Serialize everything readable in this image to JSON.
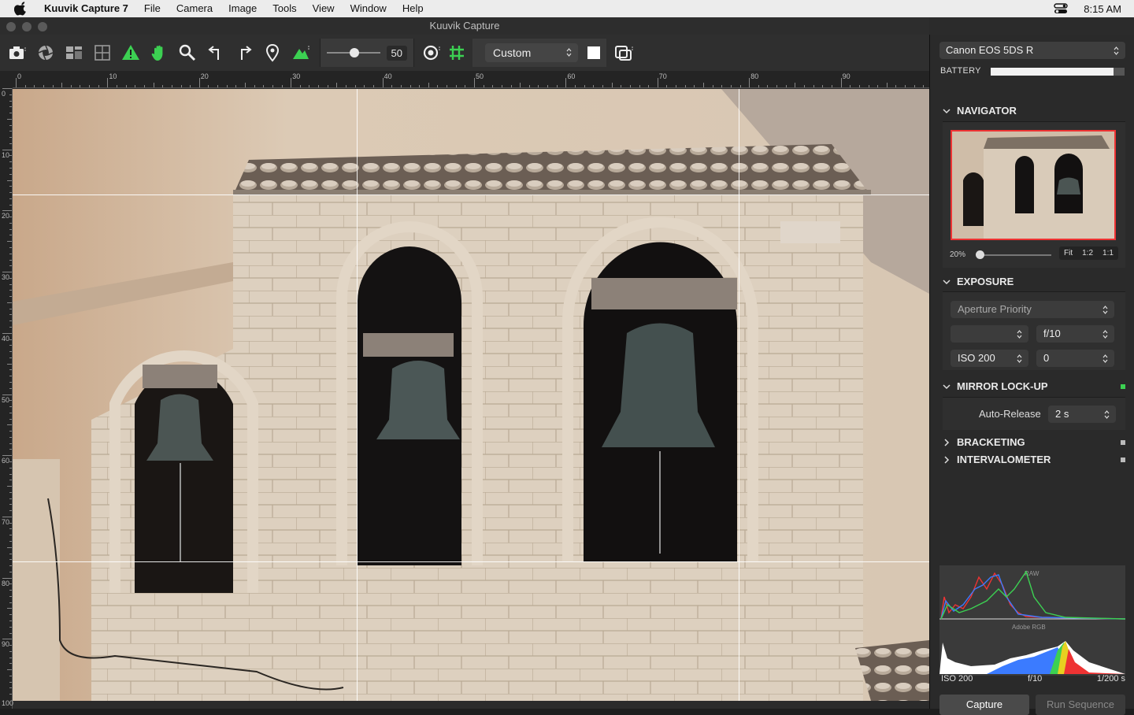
{
  "menubar": {
    "app_name": "Kuuvik Capture 7",
    "items": [
      "File",
      "Camera",
      "Image",
      "Tools",
      "View",
      "Window",
      "Help"
    ],
    "clock": "8:15 AM"
  },
  "window": {
    "title": "Kuuvik Capture"
  },
  "toolbar": {
    "zoom_value": "50",
    "zoom_fraction": 0.5,
    "white_balance": "Custom"
  },
  "ruler": {
    "h_labels": [
      "0",
      "10",
      "20",
      "30",
      "40",
      "50",
      "60",
      "70",
      "80",
      "90"
    ],
    "v_labels": [
      "0",
      "10",
      "20",
      "30",
      "40",
      "50",
      "60",
      "70",
      "80",
      "90",
      "100"
    ]
  },
  "panel": {
    "camera": "Canon EOS 5DS R",
    "battery_label": "BATTERY",
    "battery_level": 0.92,
    "navigator": {
      "title": "NAVIGATOR",
      "zoom": "20%",
      "buttons": [
        "Fit",
        "1:2",
        "1:1"
      ]
    },
    "exposure": {
      "title": "EXPOSURE",
      "mode": "Aperture Priority",
      "shutter": "",
      "aperture": "f/10",
      "iso": "ISO 200",
      "compensation": "0"
    },
    "mirror": {
      "title": "MIRROR LOCK-UP",
      "auto_release_label": "Auto-Release",
      "auto_release_value": "2 s"
    },
    "bracketing": {
      "title": "BRACKETING"
    },
    "intervalometer": {
      "title": "INTERVALOMETER"
    },
    "histogram": {
      "raw_label": "RAW",
      "rgb_label": "Adobe RGB",
      "iso": "ISO 200",
      "aperture": "f/10",
      "shutter": "1/200 s"
    },
    "capture_label": "Capture",
    "run_sequence_label": "Run Sequence"
  },
  "colors": {
    "accent_green": "#3cd052",
    "navigator_border": "#e33333"
  }
}
